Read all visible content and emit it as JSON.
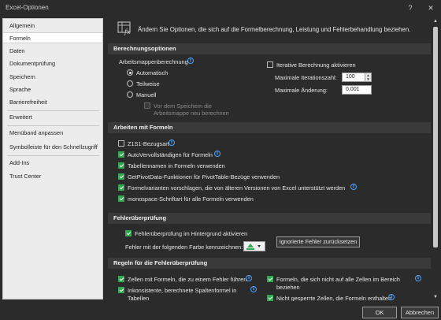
{
  "window": {
    "title": "Excel-Optionen",
    "help": "?",
    "close": "✕"
  },
  "sidebar": {
    "items": [
      {
        "label": "Allgemein"
      },
      {
        "label": "Formeln"
      },
      {
        "label": "Daten"
      },
      {
        "label": "Dokumentprüfung"
      },
      {
        "label": "Speichern"
      },
      {
        "label": "Sprache"
      },
      {
        "label": "Barrierefreiheit"
      },
      {
        "label": "Erweitert"
      },
      {
        "label": "Menüband anpassen"
      },
      {
        "label": "Symbolleiste für den Schnellzugriff"
      },
      {
        "label": "Add-Ins"
      },
      {
        "label": "Trust Center"
      }
    ]
  },
  "header": {
    "text": "Ändern Sie Optionen, die sich auf die Formelberechnung, Leistung und Fehlerbehandlung beziehen."
  },
  "berechnung": {
    "title": "Berechnungsoptionen",
    "mappe_label": "Arbeitsmappenberechnung",
    "auto": "Automatisch",
    "teil": "Teilweise",
    "manuell": "Manuell",
    "neu": "Vor dem Speichern die Arbeitsmappe neu berechnen",
    "iterativ": "Iterative Berechnung aktivieren",
    "max_iter_label": "Maximale Iterationszahl:",
    "max_iter_value": "100",
    "max_aend_label": "Maximale Änderung:",
    "max_aend_value": "0,001"
  },
  "arbeiten": {
    "title": "Arbeiten mit Formeln",
    "items": [
      {
        "label": "Z1S1-Bezugsart",
        "checked": false,
        "info": true
      },
      {
        "label": "AutoVervollständigen für Formeln",
        "checked": true,
        "info": true
      },
      {
        "label": "Tabellennamen in Formeln verwenden",
        "checked": true,
        "info": false
      },
      {
        "label": "GetPivotData-Funktionen für PivotTable-Bezüge verwenden",
        "checked": true,
        "info": false
      },
      {
        "label": "Formelvarianten vorschlagen, die von älteren Versionen von Excel unterstützt werden",
        "checked": true,
        "info": true
      },
      {
        "label": "monospace-Schriftart für alle Formeln verwenden",
        "checked": true,
        "info": false
      }
    ]
  },
  "fehler": {
    "title": "Fehlerüberprüfung",
    "hintergrund": "Fehlerüberprüfung im Hintergrund aktivieren",
    "farbe_label": "Fehler mit der folgenden Farbe kennzeichnen:",
    "ignore_btn": "Ignorierte Fehler zurücksetzen"
  },
  "regeln": {
    "title": "Regeln für die Fehlerüberprüfung",
    "left": [
      {
        "label": "Zellen mit Formeln, die zu einem Fehler führen"
      },
      {
        "label": "Inkonsistente, berechnete Spaltenformel in",
        "label2": "Tabellen"
      }
    ],
    "right": [
      {
        "label": "Formeln, die sich nicht auf alle Zellen im Bereich",
        "label2": "beziehen"
      },
      {
        "label": "Nicht gesperrte Zellen, die Formeln enthalten"
      }
    ]
  },
  "footer": {
    "ok": "OK",
    "cancel": "Abbrechen"
  },
  "colors": {
    "accent_check": "#33a852",
    "info": "#4da3ff",
    "background": "#2b2b2b",
    "section": "#3a3a3a"
  },
  "icons": [
    "help-icon",
    "close-icon",
    "formula-options-icon",
    "info-icon",
    "spin-up-icon",
    "spin-down-icon",
    "color-dropdown-icon"
  ]
}
